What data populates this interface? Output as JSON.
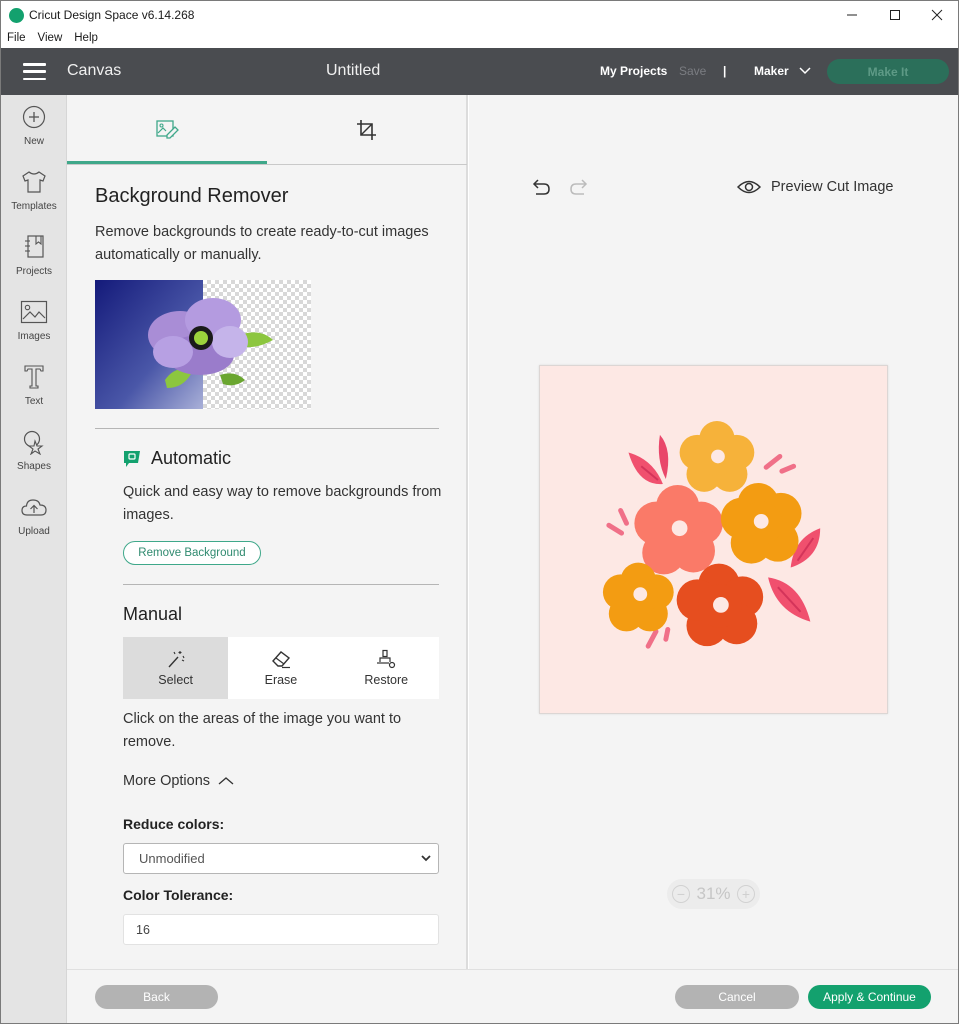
{
  "window": {
    "title": "Cricut Design Space  v6.14.268",
    "controls": {
      "minimize": "—",
      "maximize": "☐",
      "close": "✕"
    }
  },
  "menu": [
    "File",
    "View",
    "Help"
  ],
  "appbar": {
    "section": "Canvas",
    "document_title": "Untitled",
    "my_projects": "My Projects",
    "save": "Save",
    "separator": "|",
    "machine": "Maker",
    "make_it": "Make It",
    "brand_color": "#13a16e"
  },
  "sidebar": {
    "items": [
      {
        "label": "New",
        "icon": "plus-circle-icon"
      },
      {
        "label": "Templates",
        "icon": "tshirt-icon"
      },
      {
        "label": "Projects",
        "icon": "notebook-icon"
      },
      {
        "label": "Images",
        "icon": "image-icon"
      },
      {
        "label": "Text",
        "icon": "text-icon"
      },
      {
        "label": "Shapes",
        "icon": "shapes-icon"
      },
      {
        "label": "Upload",
        "icon": "cloud-upload-icon"
      }
    ]
  },
  "panel": {
    "tabs": [
      {
        "name": "background-remover",
        "icon": "image-edit-icon",
        "active": true
      },
      {
        "name": "crop",
        "icon": "crop-icon",
        "active": false
      }
    ],
    "title": "Background Remover",
    "description": "Remove backgrounds to create ready-to-cut images automatically or manually.",
    "automatic": {
      "title": "Automatic",
      "description": "Quick and easy way to remove backgrounds from images.",
      "button": "Remove Background"
    },
    "manual": {
      "title": "Manual",
      "tools": [
        {
          "label": "Select",
          "icon": "magic-wand-icon",
          "active": true
        },
        {
          "label": "Erase",
          "icon": "eraser-icon",
          "active": false
        },
        {
          "label": "Restore",
          "icon": "brush-restore-icon",
          "active": false
        }
      ],
      "description": "Click on the areas of the image you want to remove."
    },
    "more_options": "More Options",
    "reduce_colors": {
      "label": "Reduce colors:",
      "value": "Unmodified"
    },
    "color_tolerance": {
      "label": "Color Tolerance:",
      "value": "16"
    }
  },
  "canvas": {
    "preview_cut": "Preview Cut Image",
    "zoom": "31%",
    "zoom_out": "−",
    "zoom_in": "+"
  },
  "footer": {
    "back": "Back",
    "cancel": "Cancel",
    "apply": "Apply & Continue"
  }
}
